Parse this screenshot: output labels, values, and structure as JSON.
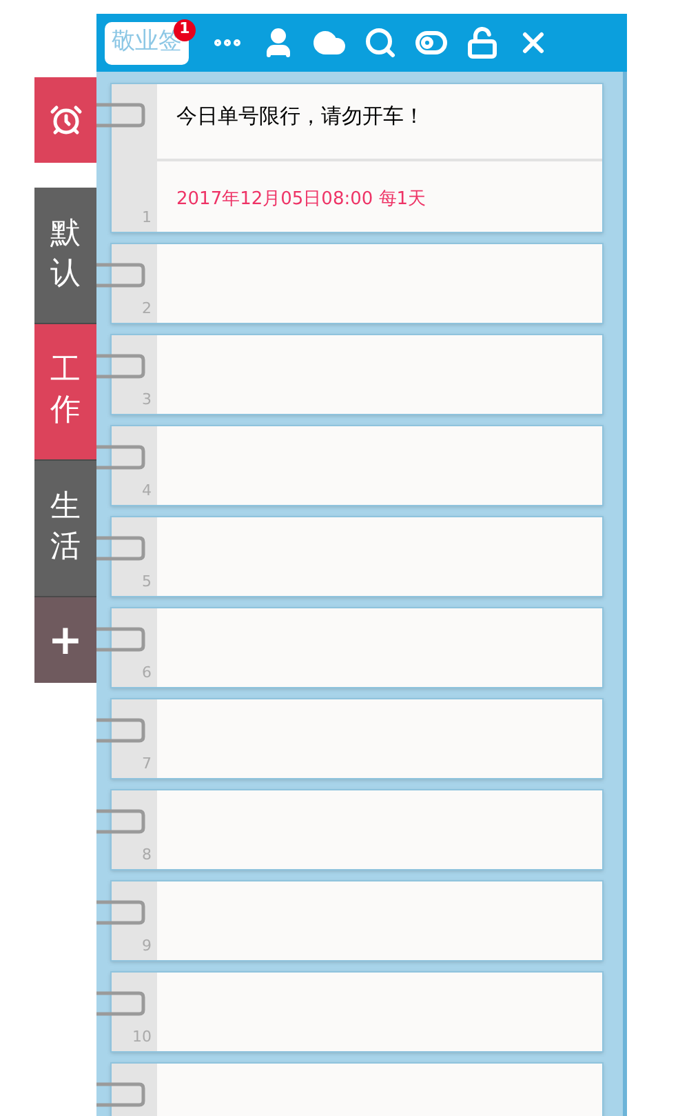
{
  "app": {
    "brand": "敬业签",
    "badge": "1"
  },
  "categories": [
    {
      "label": "默认",
      "selected": false
    },
    {
      "label": "工作",
      "selected": true
    },
    {
      "label": "生活",
      "selected": false
    }
  ],
  "add_button": {
    "label": "+"
  },
  "notes": [
    {
      "kind": "note",
      "number": "1",
      "text": "今日单号限行，请勿开车！",
      "reminder": "2017年12月05日08:00 每1天"
    },
    {
      "kind": "note",
      "number": "2"
    },
    {
      "kind": "note",
      "number": "3"
    },
    {
      "kind": "note",
      "number": "4"
    },
    {
      "kind": "note",
      "number": "5"
    },
    {
      "kind": "note",
      "number": "6"
    },
    {
      "kind": "note",
      "number": "7"
    },
    {
      "kind": "note",
      "number": "8"
    },
    {
      "kind": "note",
      "number": "9"
    },
    {
      "kind": "note",
      "number": "10"
    },
    {
      "kind": "note"
    }
  ]
}
